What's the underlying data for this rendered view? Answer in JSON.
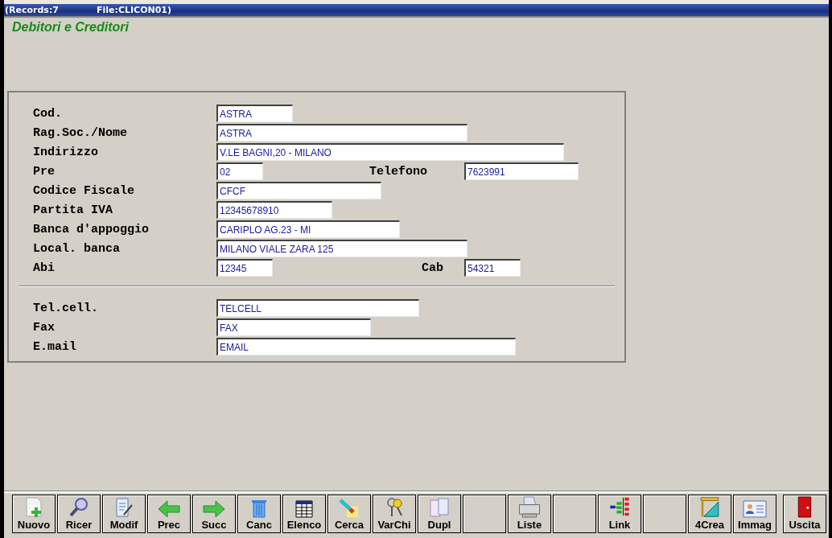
{
  "title_bar": {
    "records": "(Records:7",
    "file": "File:CLICON01)"
  },
  "heading": "Debitori e Creditori",
  "form": {
    "sections": [
      {
        "rows": [
          {
            "label": "Cod.",
            "value": "ASTRA"
          },
          {
            "label": "Rag.Soc./Nome",
            "value": "ASTRA"
          },
          {
            "label": "Indirizzo",
            "value": "V.LE BAGNI,20 - MILANO"
          },
          {
            "label": "Pre",
            "value": "02",
            "extra": {
              "label": "Telefono",
              "value": "7623991"
            }
          },
          {
            "label": "Codice Fiscale",
            "value": "CFCF"
          },
          {
            "label": "Partita IVA",
            "value": "12345678910"
          },
          {
            "label": "Banca d'appoggio",
            "value": "CARIPLO AG.23 - MI"
          },
          {
            "label": "Local. banca",
            "value": "MILANO VIALE ZARA 125"
          },
          {
            "label": "Abi",
            "value": "12345",
            "extra": {
              "label": "Cab",
              "value": "54321"
            }
          }
        ]
      },
      {
        "rows": [
          {
            "label": "Tel.cell.",
            "value": "TELCELL"
          },
          {
            "label": "Fax",
            "value": "FAX"
          },
          {
            "label": "E.mail",
            "value": "EMAIL"
          }
        ]
      }
    ]
  },
  "toolbar": [
    {
      "kind": "new",
      "label": "Nuovo"
    },
    {
      "kind": "search",
      "label": "Ricer"
    },
    {
      "kind": "edit",
      "label": "Modif"
    },
    {
      "kind": "prev",
      "label": "Prec"
    },
    {
      "kind": "next",
      "label": "Succ"
    },
    {
      "kind": "delete",
      "label": "Canc"
    },
    {
      "kind": "table",
      "label": "Elenco"
    },
    {
      "kind": "find",
      "label": "Cerca"
    },
    {
      "kind": "keys",
      "label": "VarChi"
    },
    {
      "kind": "duplicate",
      "label": "Dupl"
    },
    {
      "kind": "blank"
    },
    {
      "kind": "print",
      "label": "Liste"
    },
    {
      "kind": "blank"
    },
    {
      "kind": "link",
      "label": "Link"
    },
    {
      "kind": "blank"
    },
    {
      "kind": "create",
      "label": "4Crea"
    },
    {
      "kind": "image",
      "label": "Immag"
    },
    {
      "kind": "exit",
      "label": "Uscita"
    }
  ]
}
